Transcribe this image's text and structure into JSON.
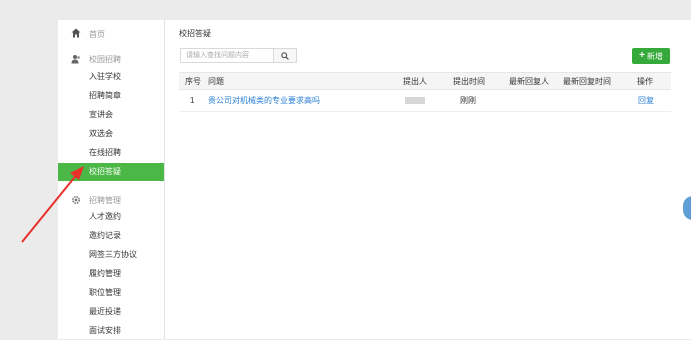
{
  "sidebar": {
    "home": "首页",
    "group1": "校园招聘",
    "group1_items": [
      "入驻学校",
      "招聘简章",
      "宣讲会",
      "双选会",
      "在线招聘",
      "校招答疑"
    ],
    "group2": "招聘管理",
    "group2_items": [
      "人才邀约",
      "邀约记录",
      "网签三方协议",
      "履约管理",
      "职位管理",
      "最近投递",
      "面试安排"
    ]
  },
  "main": {
    "title": "校招答疑",
    "search_placeholder": "请输入查找问题内容",
    "add_label": "新增",
    "columns": [
      "序号",
      "问题",
      "提出人",
      "提出时间",
      "最新回复人",
      "最新回复时间",
      "操作"
    ],
    "rows": [
      {
        "no": "1",
        "question": "贵公司对机械类的专业要求高吗",
        "time": "刚刚",
        "action": "回复"
      }
    ]
  },
  "colors": {
    "accent": "#4bb747",
    "link": "#2a7fd4",
    "arrow": "#e8312a"
  }
}
